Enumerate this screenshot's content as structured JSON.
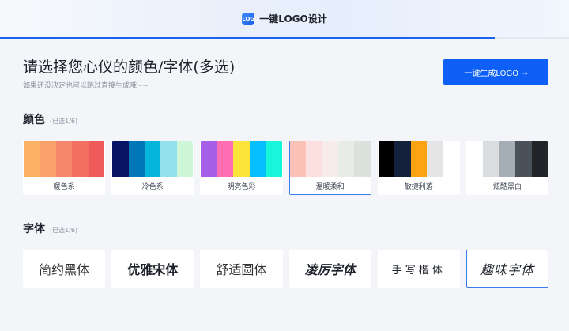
{
  "header": {
    "logo_text": "LOGO",
    "app_name": "一键LOGO设计",
    "progress_fraction": 0.87
  },
  "main": {
    "title": "请选择您心仪的颜色/字体(多选)",
    "subtitle": "如果还没决定也可以跳过直接生成哦~~",
    "generate_button": "一键生成LOGO →"
  },
  "color_section": {
    "title": "颜色",
    "count": "(已选1/6)",
    "palettes": [
      {
        "label": "暖色系",
        "colors": [
          "#fbb265",
          "#f9a06b",
          "#f7876a",
          "#f36f61",
          "#ef5b5b"
        ],
        "selected": false
      },
      {
        "label": "冷色系",
        "colors": [
          "#071463",
          "#0177b8",
          "#06b5dc",
          "#93e1ef",
          "#cdf7d8"
        ],
        "selected": false
      },
      {
        "label": "明亮色彩",
        "colors": [
          "#a660e7",
          "#fe6cb2",
          "#fee33b",
          "#05bffe",
          "#17f5da"
        ],
        "selected": false
      },
      {
        "label": "温暖柔和",
        "colors": [
          "#fcc2b8",
          "#fce0e0",
          "#f7ecea",
          "#e9ebe7",
          "#dbe1dc"
        ],
        "selected": true
      },
      {
        "label": "敏捷利落",
        "colors": [
          "#000000",
          "#14213d",
          "#fca311",
          "#e5e5e5",
          "#ffffff"
        ],
        "selected": false
      },
      {
        "label": "炫酷黑白",
        "colors": [
          "#ffffff",
          "#dadde0",
          "#a6aeb5",
          "#4b5159",
          "#212529"
        ],
        "selected": false
      }
    ]
  },
  "font_section": {
    "title": "字体",
    "count": "(已选1/6)",
    "fonts": [
      {
        "label": "简约黑体",
        "selected": false
      },
      {
        "label": "优雅宋体",
        "selected": false
      },
      {
        "label": "舒适圆体",
        "selected": false
      },
      {
        "label": "凌厉字体",
        "selected": false
      },
      {
        "label": "手写楷体",
        "selected": false
      },
      {
        "label": "趣味字体",
        "selected": true
      }
    ]
  }
}
